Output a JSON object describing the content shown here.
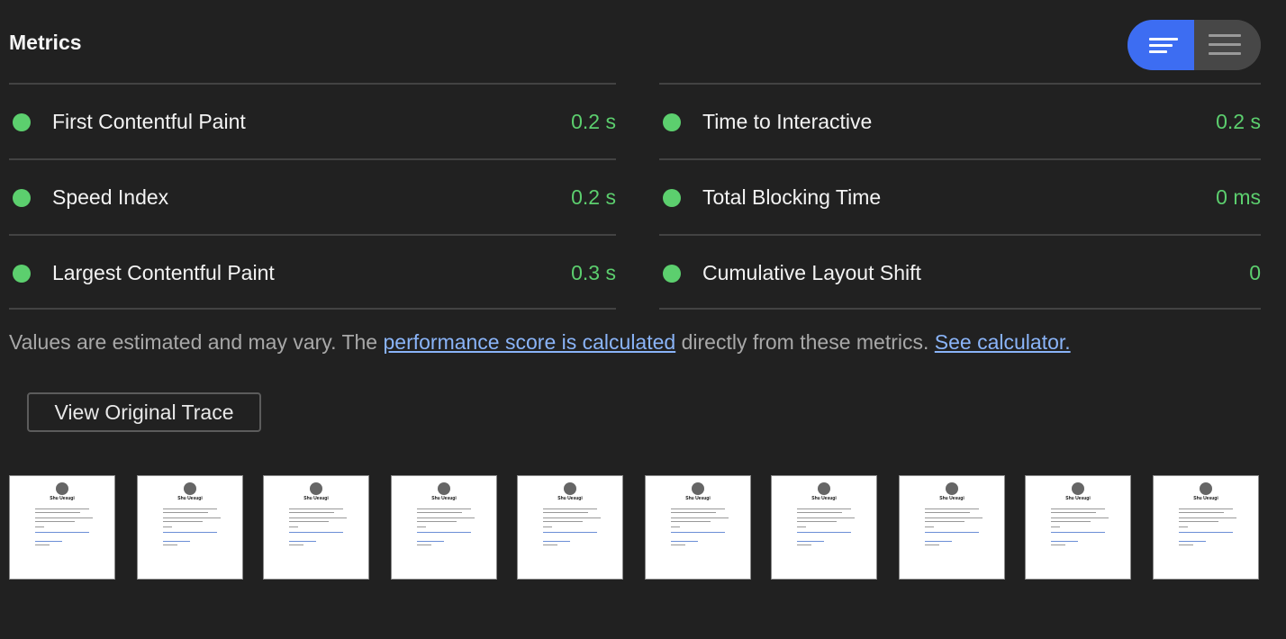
{
  "header": {
    "title": "Metrics"
  },
  "view_toggle": {
    "options": [
      "bar-chart-view-icon",
      "list-view-icon"
    ],
    "active": "bar-chart-view-icon",
    "accent_color": "#3d6df2"
  },
  "metrics": {
    "left": [
      {
        "label": "First Contentful Paint",
        "value": "0.2 s",
        "status": "pass"
      },
      {
        "label": "Speed Index",
        "value": "0.2 s",
        "status": "pass"
      },
      {
        "label": "Largest Contentful Paint",
        "value": "0.3 s",
        "status": "pass"
      }
    ],
    "right": [
      {
        "label": "Time to Interactive",
        "value": "0.2 s",
        "status": "pass"
      },
      {
        "label": "Total Blocking Time",
        "value": "0 ms",
        "status": "pass"
      },
      {
        "label": "Cumulative Layout Shift",
        "value": "0",
        "status": "pass"
      }
    ],
    "pass_color": "#5ccf6e"
  },
  "note": {
    "prefix": "Values are estimated and may vary. The ",
    "link1": "performance score is calculated",
    "middle": " directly from these metrics. ",
    "link2": "See calculator."
  },
  "actions": {
    "view_trace_label": "View Original Trace"
  },
  "filmstrip": {
    "frame_count": 10,
    "frame_name_text": "Shu Uesugi"
  }
}
